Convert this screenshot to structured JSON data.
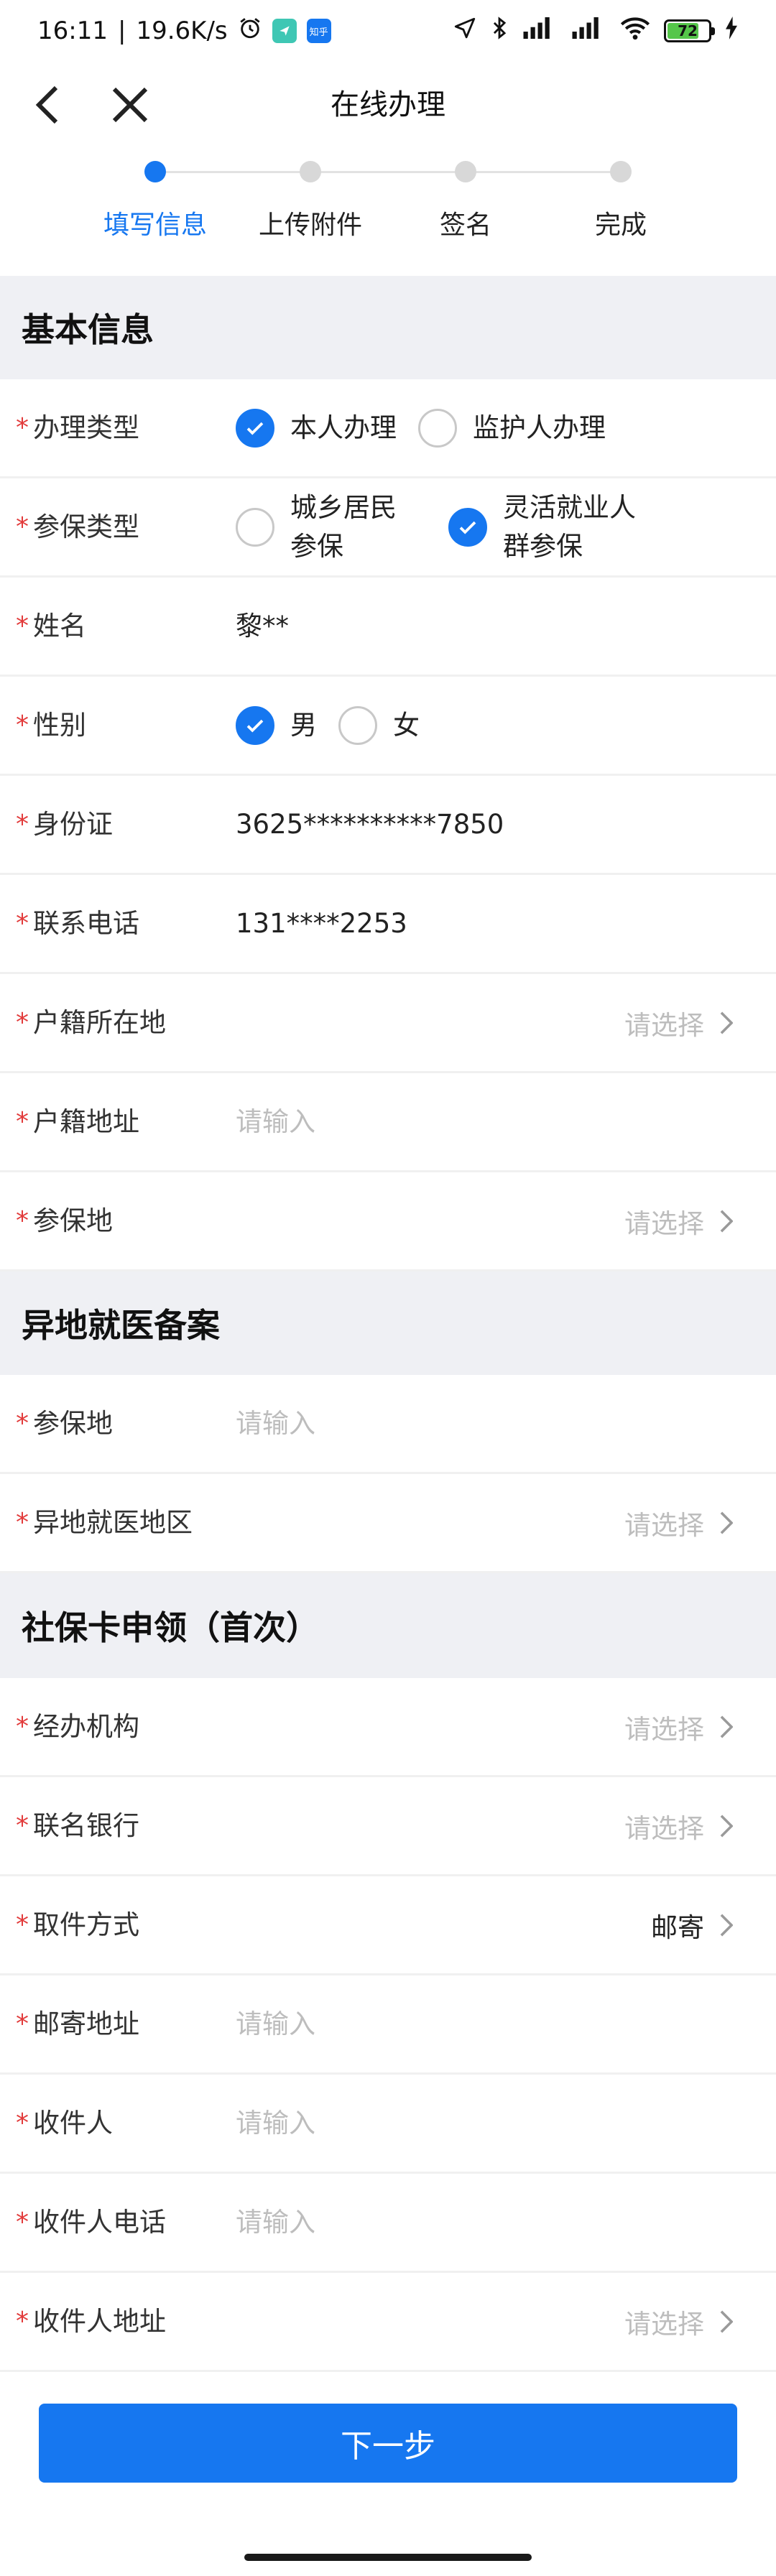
{
  "status_bar": {
    "time": "16:11",
    "separator": "|",
    "net_speed": "19.6K/s",
    "app2_label": "知乎",
    "battery_level": "72"
  },
  "nav": {
    "title": "在线办理"
  },
  "steps": [
    {
      "label": "填写信息",
      "active": true
    },
    {
      "label": "上传附件",
      "active": false
    },
    {
      "label": "签名",
      "active": false
    },
    {
      "label": "完成",
      "active": false
    }
  ],
  "sections": {
    "basic": "基本信息",
    "remote": "异地就医备案",
    "card": "社保卡申领（首次）"
  },
  "required_mark": "*",
  "form": {
    "handle_type": {
      "label": "办理类型",
      "options": [
        "本人办理",
        "监护人办理"
      ],
      "selected": 0
    },
    "insure_type": {
      "label": "参保类型",
      "options": [
        [
          "城乡居民",
          "参保"
        ],
        [
          "灵活就业人",
          "群参保"
        ]
      ],
      "selected": 1
    },
    "name": {
      "label": "姓名",
      "value": "黎**"
    },
    "gender": {
      "label": "性别",
      "options": [
        "男",
        "女"
      ],
      "selected": 0
    },
    "id_card": {
      "label": "身份证",
      "value": "3625**********7850"
    },
    "phone": {
      "label": "联系电话",
      "value": "131****2253"
    },
    "household_location": {
      "label": "户籍所在地",
      "placeholder": "请选择"
    },
    "household_address": {
      "label": "户籍地址",
      "placeholder": "请输入"
    },
    "insured_place": {
      "label": "参保地",
      "placeholder": "请选择"
    },
    "remote_insured_place": {
      "label": "参保地",
      "placeholder": "请输入"
    },
    "remote_region": {
      "label": "异地就医地区",
      "placeholder": "请选择"
    },
    "agency": {
      "label": "经办机构",
      "placeholder": "请选择"
    },
    "bank": {
      "label": "联名银行",
      "placeholder": "请选择"
    },
    "pickup_method": {
      "label": "取件方式",
      "value": "邮寄"
    },
    "mail_address": {
      "label": "邮寄地址",
      "placeholder": "请输入"
    },
    "recipient": {
      "label": "收件人",
      "placeholder": "请输入"
    },
    "recipient_phone": {
      "label": "收件人电话",
      "placeholder": "请输入"
    },
    "recipient_address": {
      "label": "收件人地址",
      "placeholder": "请选择"
    }
  },
  "next_button": "下一步",
  "colors": {
    "accent": "#1677f0",
    "required": "#e23b3b",
    "section_bg": "#eff0f4",
    "placeholder": "#bdbdbd"
  }
}
